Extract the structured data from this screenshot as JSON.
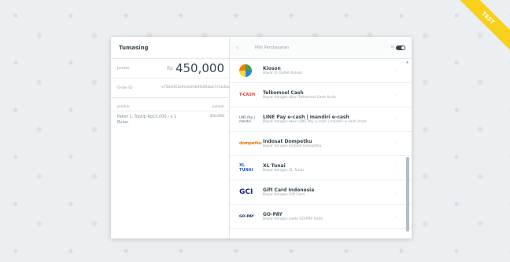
{
  "badge": "TEST",
  "left": {
    "merchant": "Tumasing",
    "amount_label": "Jumlah",
    "currency": "Rp",
    "amount": "450,000",
    "order_id_label": "Order ID",
    "order_id": "e75b0d61b9e4a93b9fb66abb7e1b3ba",
    "details_header_left": "produk",
    "details_header_right": "jumlah",
    "items": [
      {
        "name": "Paket 1, TopUp Rp15,000,- x 1 Bulan",
        "price": "450,000"
      }
    ]
  },
  "right": {
    "title": "Pilih Pembayaran",
    "lang": "id",
    "methods": [
      {
        "name": "Kioson",
        "desc": "Bayar di Outlet Kioson",
        "icon": "kioson-logo",
        "logo_text": ""
      },
      {
        "name": "Telkomsel Cash",
        "desc": "Bayar dengan akun Telkomsel Cash Anda",
        "icon": "tcash-logo",
        "logo_text": "T-CASH"
      },
      {
        "name": "LINE Pay e-cash | mandiri e-cash",
        "desc": "Bayar dengan akun LINE Pay e-cash | mandiri e-cash Anda",
        "icon": "line-pay-logo",
        "logo_text": "LINE Pay | mandiri"
      },
      {
        "name": "Indosat Dompetku",
        "desc": "Bayar dengan Indosat Dompetku",
        "icon": "indosat-logo",
        "logo_text": "dompetku"
      },
      {
        "name": "XL Tunai",
        "desc": "Bayar dengan XL Tunai",
        "icon": "xl-tunai-logo",
        "logo_text": "XL TUNAI"
      },
      {
        "name": "Gift Card Indonesia",
        "desc": "Bayar dengan Gift Card",
        "icon": "gci-logo",
        "logo_text": "GCI"
      },
      {
        "name": "GO-PAY",
        "desc": "Bayar dengan saldo GO-PAY Anda",
        "icon": "gopay-logo",
        "logo_text": "GO-PAY"
      }
    ]
  }
}
